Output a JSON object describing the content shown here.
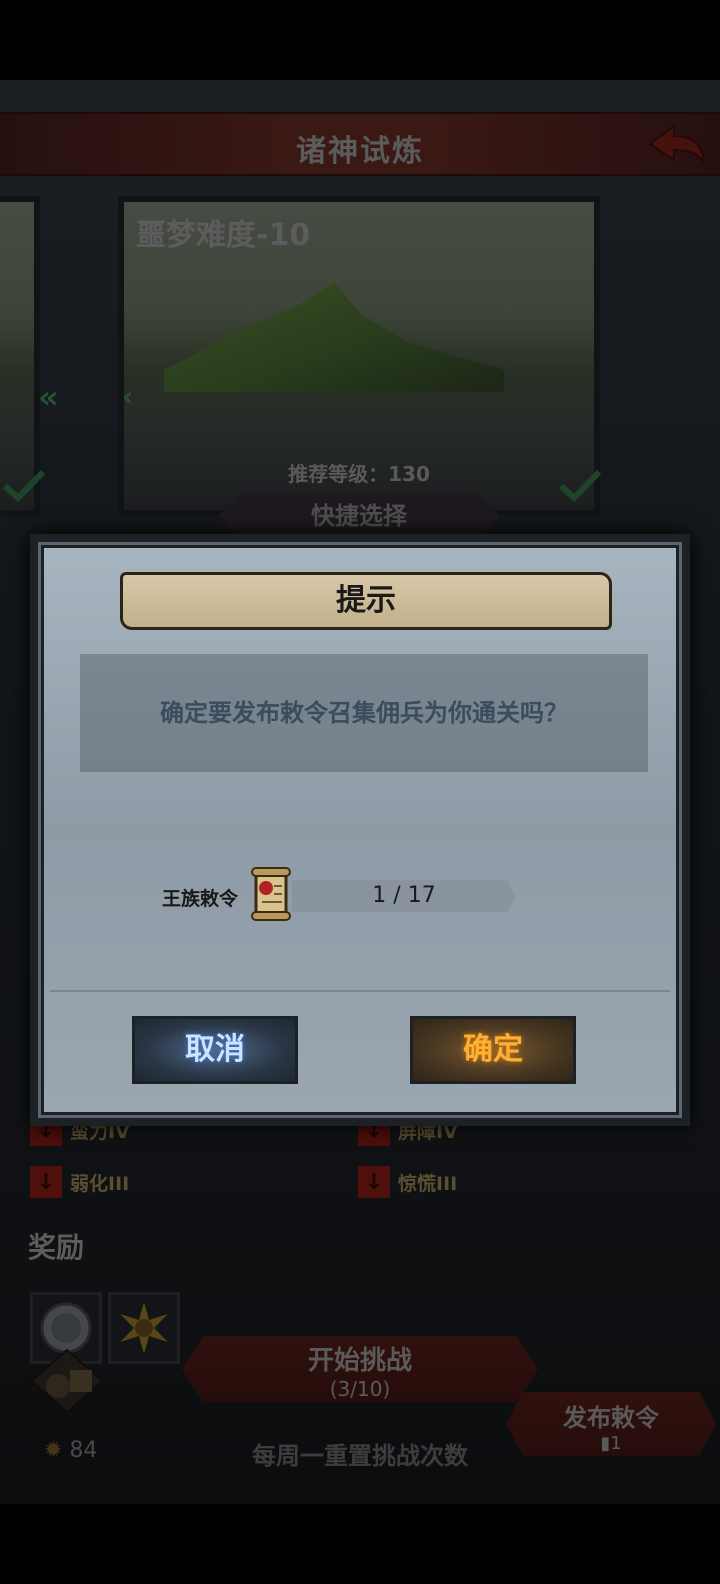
{
  "header": {
    "title": "诸神试炼"
  },
  "stage": {
    "title": "噩梦难度-10",
    "recommended_level": "推荐等级：130",
    "quick_select_label": "快捷选择"
  },
  "debuffs": [
    {
      "label": "蛮力IV"
    },
    {
      "label": "屏障IV"
    },
    {
      "label": "弱化III"
    },
    {
      "label": "惊慌III"
    }
  ],
  "rewards": {
    "title": "奖励"
  },
  "actions": {
    "start_label": "开始挑战",
    "start_count": "(3/10)",
    "publish_label": "发布敕令",
    "publish_count": "1",
    "weekly_reset": "每周一重置挑战次数",
    "coins": "84"
  },
  "dialog": {
    "title": "提示",
    "message": "确定要发布敕令召集佣兵为你通关吗？",
    "item_label": "王族敕令",
    "item_count": "1 / 17",
    "cancel_label": "取消",
    "confirm_label": "确定"
  },
  "colors": {
    "cancel_glow": "#3a7bd5",
    "confirm_glow": "#ffb030",
    "header_bar": "#5a2620"
  }
}
